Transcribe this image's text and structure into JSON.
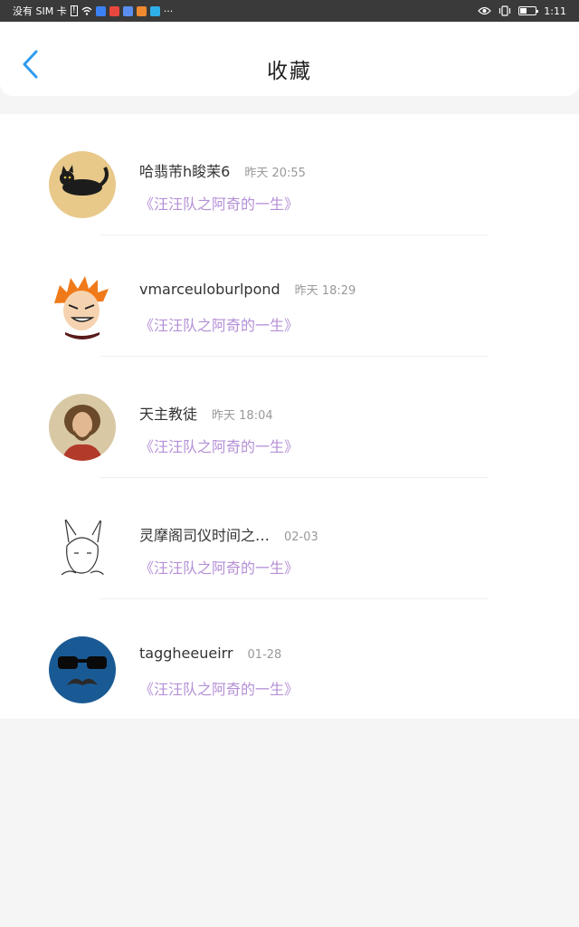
{
  "status_bar": {
    "carrier": "没有 SIM 卡",
    "more": "···",
    "time": "1:11",
    "battery_level": 0.45
  },
  "header": {
    "title": "收藏"
  },
  "items": [
    {
      "username": "哈翡芾h睃茉6",
      "time": "昨天 20:55",
      "book": "《汪汪队之阿奇的一生》",
      "avatar": "cat-avatar"
    },
    {
      "username": "vmarceuloburlpond",
      "time": "昨天 18:29",
      "book": "《汪汪队之阿奇的一生》",
      "avatar": "orange-hair-cartoon-avatar"
    },
    {
      "username": "天主教徒",
      "time": "昨天 18:04",
      "book": "《汪汪队之阿奇的一生》",
      "avatar": "jesus-painting-avatar"
    },
    {
      "username": "灵摩阁司仪时间之…",
      "time": "02-03",
      "book": "《汪汪队之阿奇的一生》",
      "avatar": "sketch-girl-avatar"
    },
    {
      "username": "taggheeueirr",
      "time": "01-28",
      "book": "《汪汪队之阿奇的一生》",
      "avatar": "sunglasses-mustache-avatar"
    }
  ],
  "colors": {
    "accent": "#2e9bf0",
    "book_title": "#b48fd6",
    "status_bar": "#3a3a3a"
  }
}
